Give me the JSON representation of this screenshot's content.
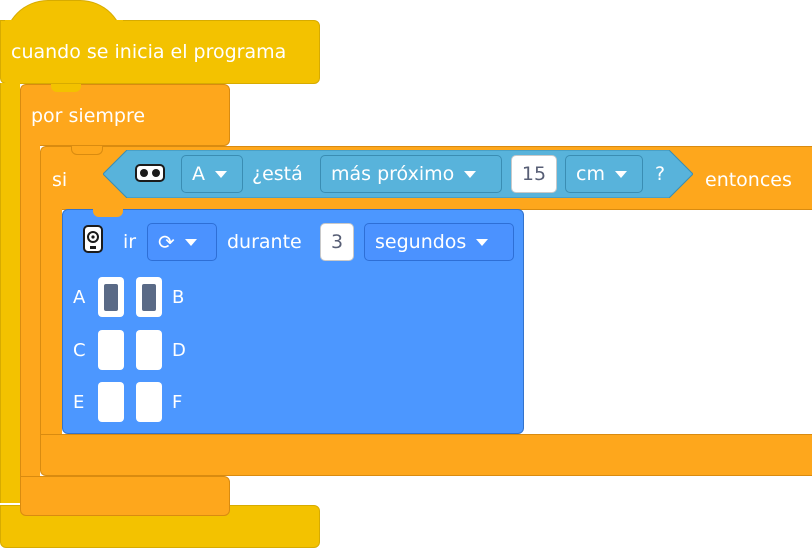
{
  "colors": {
    "event": "#f3c200",
    "control": "#fea71c",
    "sensor": "#58b3db",
    "motor": "#4c97ff"
  },
  "event_block": {
    "label": "cuando se inicia el programa"
  },
  "forever_block": {
    "label": "por siempre"
  },
  "if_block": {
    "label_si": "si",
    "label_then": "entonces"
  },
  "condition": {
    "sensor_icon": "distance-sensor-icon",
    "port": "A",
    "label_is": "¿está",
    "comparison": "más próximo",
    "value": "15",
    "unit": "cm",
    "question_mark": "?"
  },
  "move_block": {
    "icon": "movement-motors-icon",
    "label_go": "ir",
    "direction_icon": "rotate-clockwise-icon",
    "label_for": "durante",
    "value": "3",
    "unit": "segundos",
    "ports": [
      {
        "left": "A",
        "right": "B",
        "left_selected": true,
        "right_selected": true
      },
      {
        "left": "C",
        "right": "D",
        "left_selected": false,
        "right_selected": false
      },
      {
        "left": "E",
        "right": "F",
        "left_selected": false,
        "right_selected": false
      }
    ]
  }
}
